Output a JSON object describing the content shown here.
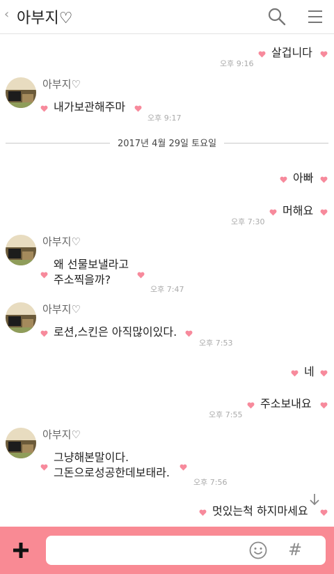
{
  "header": {
    "back_glyph": "‹",
    "title": "아부지♡",
    "search_icon": "search-icon",
    "menu_icon": "menu-icon"
  },
  "messages": [
    {
      "text": "살겁니다",
      "time": "오후 9:16"
    },
    {
      "sender": "아부지♡",
      "text": "내가보관해주마",
      "time": "오후 9:17"
    },
    {
      "date": "2017년 4월 29일 토요일"
    },
    {
      "text": "아빠"
    },
    {
      "text": "머해요",
      "time": "오후 7:30"
    },
    {
      "sender": "아부지♡",
      "text": "왜 선물보낼라고\n주소찍을까?",
      "time": "오후 7:47"
    },
    {
      "sender": "아부지♡",
      "text": "로션,스킨은 아직많이있다.",
      "time": "오후 7:53"
    },
    {
      "text": "네"
    },
    {
      "text": "주소보내요",
      "time": "오후 7:55"
    },
    {
      "sender": "아부지♡",
      "text": "그냥해본말이다.\n그돈으로성공한데보태라.",
      "time": "오후 7:56"
    },
    {
      "text": "멋있는척 하지마세요"
    }
  ],
  "input_bar": {
    "plus_icon": "plus-icon",
    "emoji_icon": "emoji-icon",
    "hash_label": "#"
  },
  "colors": {
    "accent": "#f98a94",
    "heart": "#f78a9c"
  }
}
